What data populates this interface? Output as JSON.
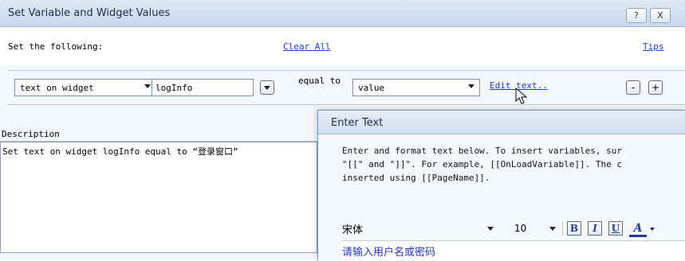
{
  "window": {
    "title": "Set Variable and Widget Values",
    "help_btn": "?",
    "close_btn": "X"
  },
  "header": {
    "set_label": "Set the following:",
    "clear_all": "Clear All",
    "tips": "Tips"
  },
  "row": {
    "target_type": "text on widget",
    "widget_name": "logInfo",
    "equal_to": "equal to",
    "value_type": "value",
    "edit_text": "Edit text..",
    "minus": "-",
    "plus": "+"
  },
  "description": {
    "label": "Description",
    "text": "Set text on widget logInfo equal to “登录窗口”"
  },
  "enter_text": {
    "title": "Enter Text",
    "line1": "Enter and format text below. To insert variables, sur",
    "line2": "\"[[\" and \"]]\". For example, [[OnLoadVariable]]. The c",
    "line3": "inserted using [[PageName]].",
    "font": "宋体",
    "size": "10",
    "bold": "B",
    "italic": "I",
    "underline": "U",
    "color": "A",
    "content": "请输入用户名或密码"
  }
}
